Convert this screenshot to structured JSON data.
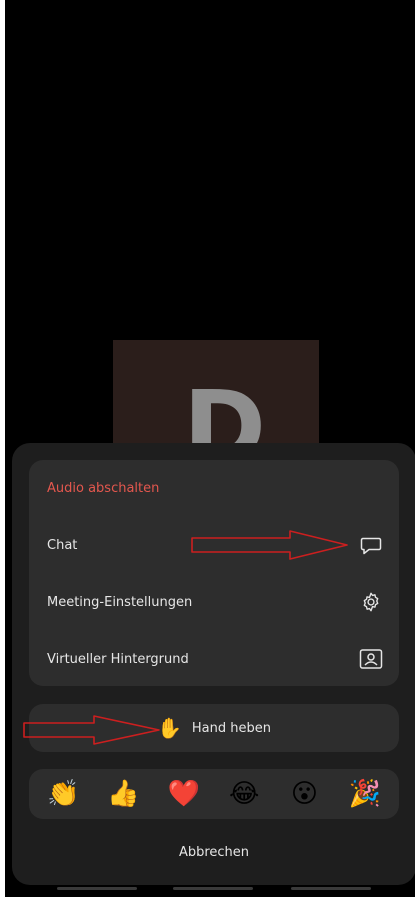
{
  "video": {
    "participant_initial": "D"
  },
  "menu": {
    "items": [
      {
        "label": "Audio abschalten",
        "icon": "",
        "style": "danger"
      },
      {
        "label": "Chat",
        "icon": "chat-bubble-icon"
      },
      {
        "label": "Meeting-Einstellungen",
        "icon": "gear-icon"
      },
      {
        "label": "Virtueller Hintergrund",
        "icon": "portrait-icon"
      }
    ]
  },
  "raise_hand": {
    "emoji": "✋",
    "label": "Hand heben"
  },
  "reactions": [
    {
      "emoji": "👏",
      "icon": "clapping-hands-icon"
    },
    {
      "emoji": "👍",
      "icon": "thumbs-up-icon"
    },
    {
      "emoji": "❤️",
      "icon": "red-heart-icon"
    },
    {
      "emoji": "😂",
      "icon": "tears-of-joy-icon"
    },
    {
      "emoji": "😮",
      "icon": "surprised-face-icon"
    },
    {
      "emoji": "🎉",
      "icon": "party-popper-icon"
    }
  ],
  "cancel_label": "Abbrechen",
  "colors": {
    "screen_bg": "#000000",
    "sheet_bg": "#1e1e1e",
    "card_bg": "#2d2d2d",
    "danger_text": "#e3574e",
    "annotation_arrow": "#cc1f1f"
  }
}
